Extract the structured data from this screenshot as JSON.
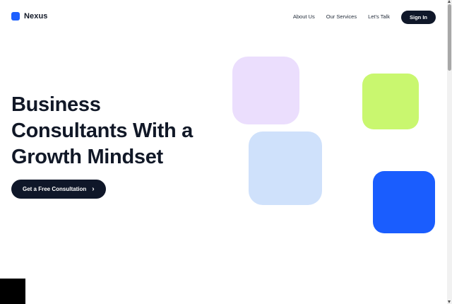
{
  "header": {
    "brand_name": "Nexus",
    "nav": {
      "about": "About Us",
      "services": "Our Services",
      "talk": "Let's Talk"
    },
    "signin_label": "Sign In"
  },
  "hero": {
    "headline_lines": [
      "Business",
      "Consultants With a",
      "Growth Mindset"
    ],
    "cta_label": "Get a Free Consultation",
    "cta_icon": "chevron-right-icon"
  },
  "colors": {
    "brand": "#1d5ffe",
    "dark": "#0f1729",
    "tile_purple": "#ebdefd",
    "tile_lightblue": "#cfe1fb",
    "tile_lime": "#c9f76f",
    "tile_blue": "#1a5dfe"
  }
}
